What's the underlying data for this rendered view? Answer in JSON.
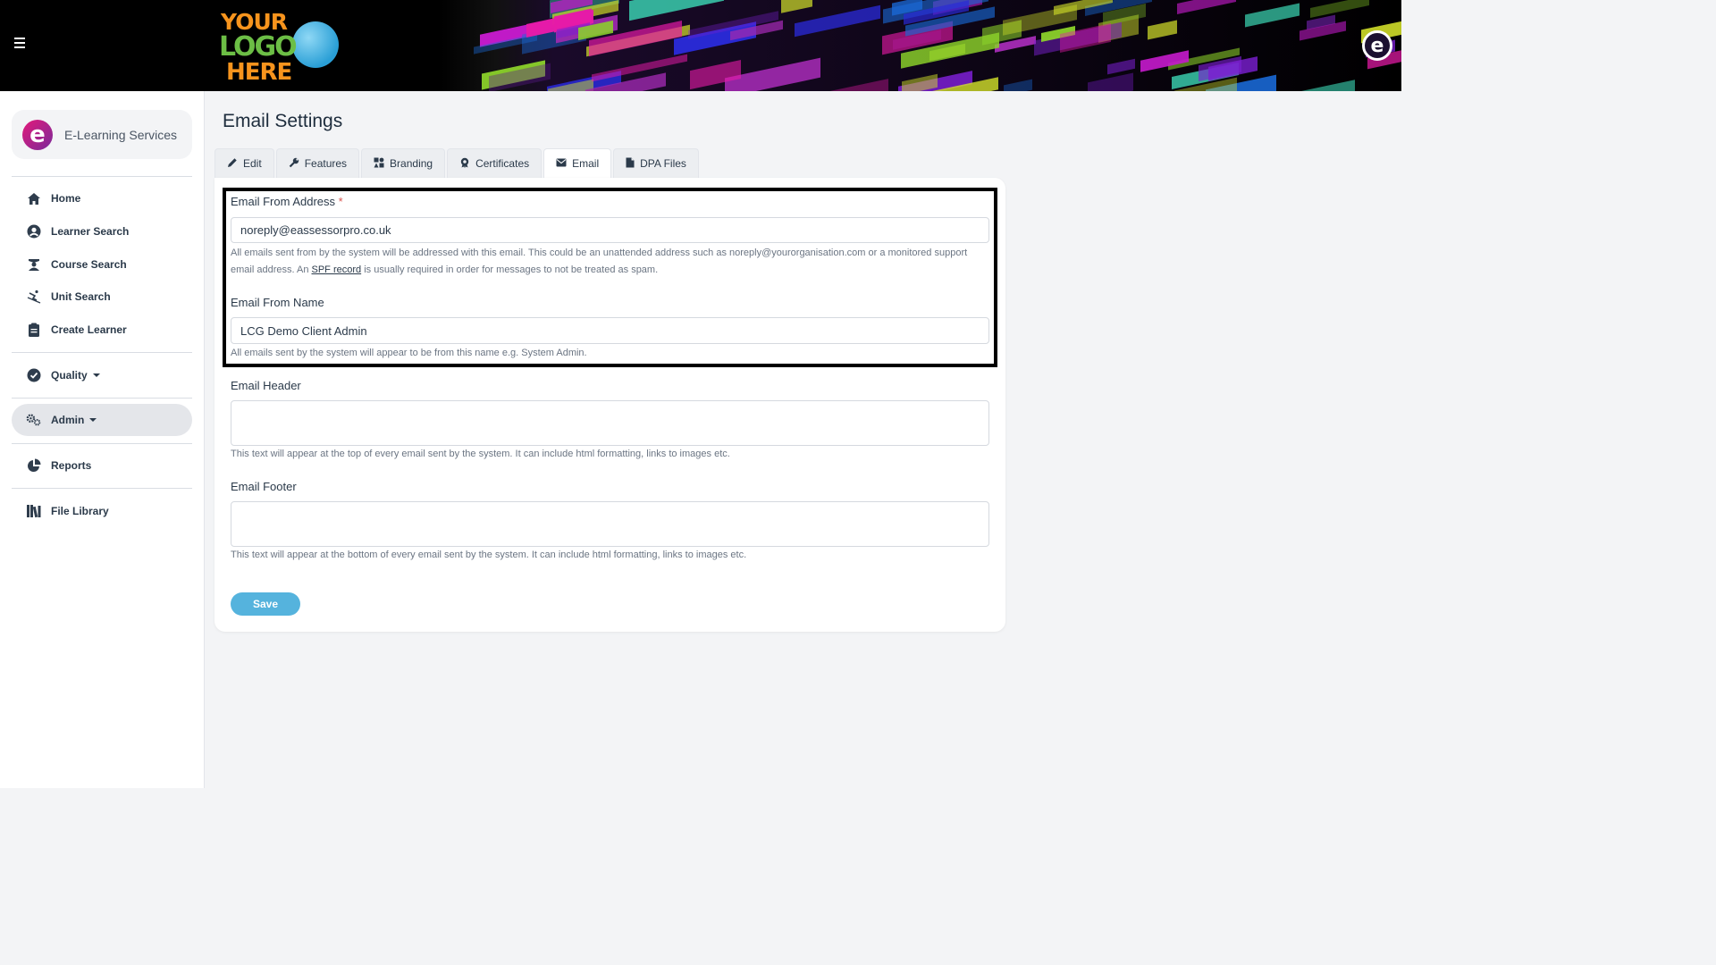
{
  "header": {
    "logo_lines": [
      "YOUR",
      "LOGO",
      "HERE"
    ],
    "badge": "e"
  },
  "sidebar": {
    "brand": {
      "icon": "e",
      "name": "E-Learning Services"
    },
    "items": [
      {
        "label": "Home",
        "icon": "home-icon"
      },
      {
        "label": "Learner Search",
        "icon": "user-circle-icon"
      },
      {
        "label": "Course Search",
        "icon": "graduate-icon"
      },
      {
        "label": "Unit Search",
        "icon": "skier-icon"
      },
      {
        "label": "Create Learner",
        "icon": "clipboard-icon"
      },
      {
        "label": "Quality",
        "icon": "check-circle-icon"
      },
      {
        "label": "Admin",
        "icon": "cogs-icon"
      },
      {
        "label": "Reports",
        "icon": "pie-chart-icon"
      },
      {
        "label": "File Library",
        "icon": "books-icon"
      }
    ]
  },
  "main": {
    "title": "Email Settings",
    "tabs": [
      {
        "label": "Edit",
        "icon": "pencil-icon"
      },
      {
        "label": "Features",
        "icon": "wrench-icon"
      },
      {
        "label": "Branding",
        "icon": "palette-icon"
      },
      {
        "label": "Certificates",
        "icon": "certificate-icon"
      },
      {
        "label": "Email",
        "icon": "envelope-icon"
      },
      {
        "label": "DPA Files",
        "icon": "file-icon"
      }
    ],
    "form": {
      "from_address": {
        "label": "Email From Address",
        "required": "*",
        "value": "noreply@eassessorpro.co.uk",
        "help_before": "All emails sent from by the system will be addressed with this email. This could be an unattended address such as noreply@yourorganisation.com or a monitored support email address. An ",
        "help_link": "SPF record",
        "help_after": " is usually required in order for messages to not be treated as spam."
      },
      "from_name": {
        "label": "Email From Name",
        "value": "LCG Demo Client Admin",
        "help": "All emails sent by the system will appear to be from this name e.g. System Admin."
      },
      "header": {
        "label": "Email Header",
        "value": "",
        "help": "This text will appear at the top of every email sent by the system. It can include html formatting, links to images etc."
      },
      "footer": {
        "label": "Email Footer",
        "value": "",
        "help": "This text will appear at the bottom of every email sent by the system. It can include html formatting, links to images etc."
      },
      "save_label": "Save"
    }
  },
  "colors": {
    "accent": "#55b3dd",
    "required": "#d9534f",
    "header_bg": "#000000"
  }
}
